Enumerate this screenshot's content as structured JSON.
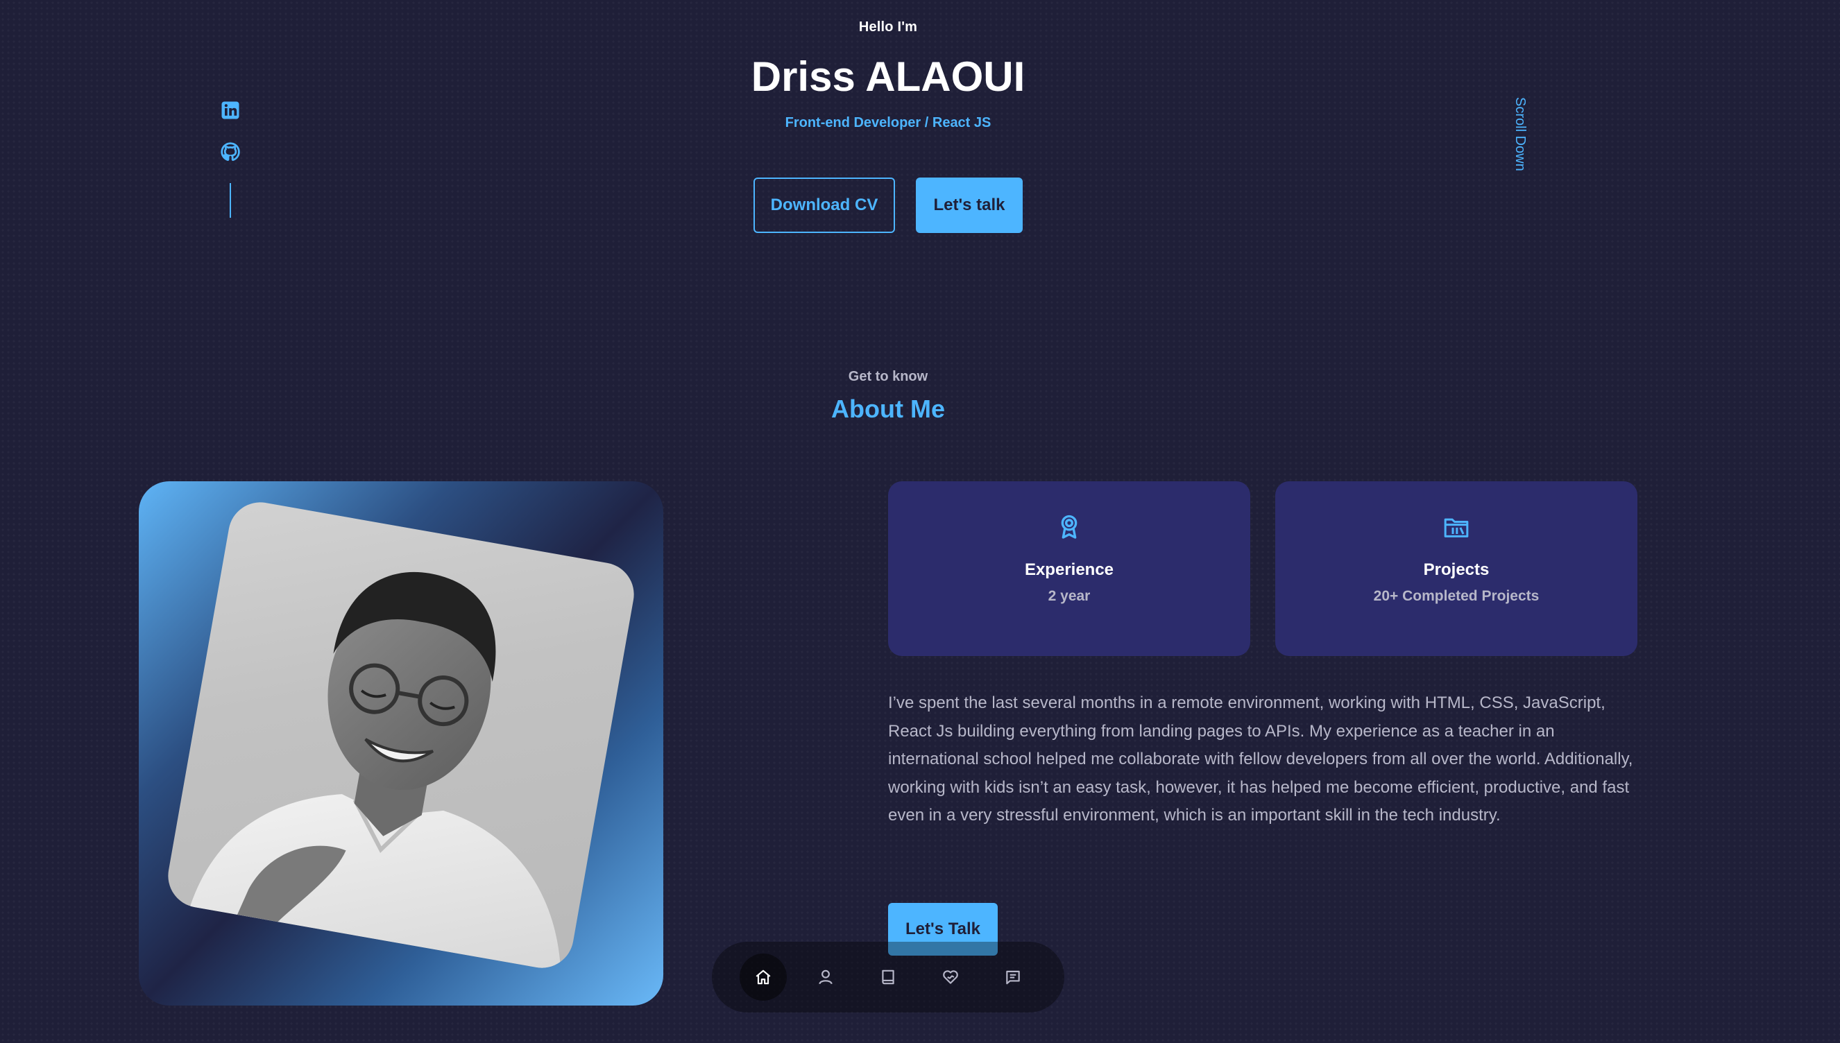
{
  "header": {
    "greeting": "Hello I'm",
    "name": "Driss ALAOUI",
    "role": "Front-end Developer / React JS",
    "buttons": {
      "download_cv": "Download CV",
      "lets_talk": "Let's talk"
    },
    "socials": [
      {
        "icon": "linkedin-icon"
      },
      {
        "icon": "github-icon"
      }
    ],
    "scroll_down": "Scroll Down"
  },
  "about": {
    "eyebrow": "Get to know",
    "title": "About Me",
    "cards": [
      {
        "icon": "award-icon",
        "title": "Experience",
        "value": "2 year"
      },
      {
        "icon": "folder-icon",
        "title": "Projects",
        "value": "20+ Completed Projects"
      }
    ],
    "text": "I’ve spent the last several months in a remote environment, working with HTML, CSS, JavaScript, React Js building everything from landing pages to APIs. My experience as a teacher in an international school helped me collaborate with fellow developers from all over the world. Additionally, working with kids isn’t an easy task, however, it has helped me become efficient, productive, and fast even in a very stressful environment, which is an important skill in the tech industry.",
    "cta": "Let's Talk"
  },
  "nav": {
    "items": [
      {
        "icon": "home-icon",
        "active": true
      },
      {
        "icon": "user-icon",
        "active": false
      },
      {
        "icon": "book-icon",
        "active": false
      },
      {
        "icon": "services-icon",
        "active": false
      },
      {
        "icon": "message-icon",
        "active": false
      }
    ]
  },
  "colors": {
    "background": "#1f1f38",
    "primary": "#4db5ff",
    "card": "#2c2c6c",
    "text_light": "#b7b7c9",
    "white": "#ffffff"
  }
}
